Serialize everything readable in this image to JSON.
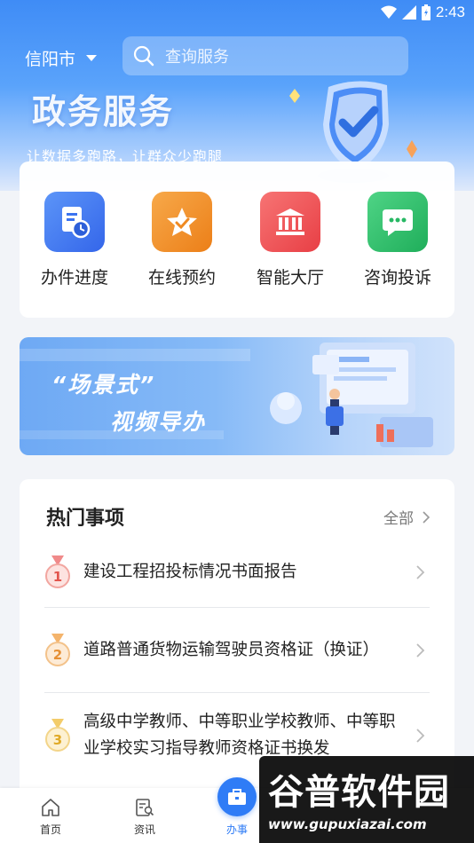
{
  "status_bar": {
    "time": "2:43"
  },
  "header": {
    "city": "信阳市",
    "search_placeholder": "查询服务",
    "title": "政务服务",
    "subtitle": "让数据多跑路，让群众少跑腿"
  },
  "quick_actions": [
    {
      "label": "办件进度",
      "icon": "document-clock-icon",
      "color": "#3b73f0"
    },
    {
      "label": "在线预约",
      "icon": "star-check-icon",
      "color": "#f2932a"
    },
    {
      "label": "智能大厅",
      "icon": "government-building-icon",
      "color": "#f2555a"
    },
    {
      "label": "咨询投诉",
      "icon": "chat-bubble-icon",
      "color": "#2ebf6a"
    }
  ],
  "banner": {
    "line1": "“场景式”",
    "line2": "视频导办"
  },
  "hot_items": {
    "title": "热门事项",
    "all_label": "全部",
    "items": [
      {
        "rank": "1",
        "text": "建设工程招投标情况书面报告"
      },
      {
        "rank": "2",
        "text": "道路普通货物运输驾驶员资格证（换证）"
      },
      {
        "rank": "3",
        "text": "高级中学教师、中等职业学校教师、中等职业学校实习指导教师资格证书换发"
      }
    ]
  },
  "tab_bar": [
    {
      "label": "首页",
      "icon": "home-icon"
    },
    {
      "label": "资讯",
      "icon": "news-search-icon"
    },
    {
      "label": "办事",
      "icon": "briefcase-icon"
    }
  ],
  "watermark": {
    "brand": "谷普软件园",
    "url": "www.gupuxiazai.com"
  }
}
